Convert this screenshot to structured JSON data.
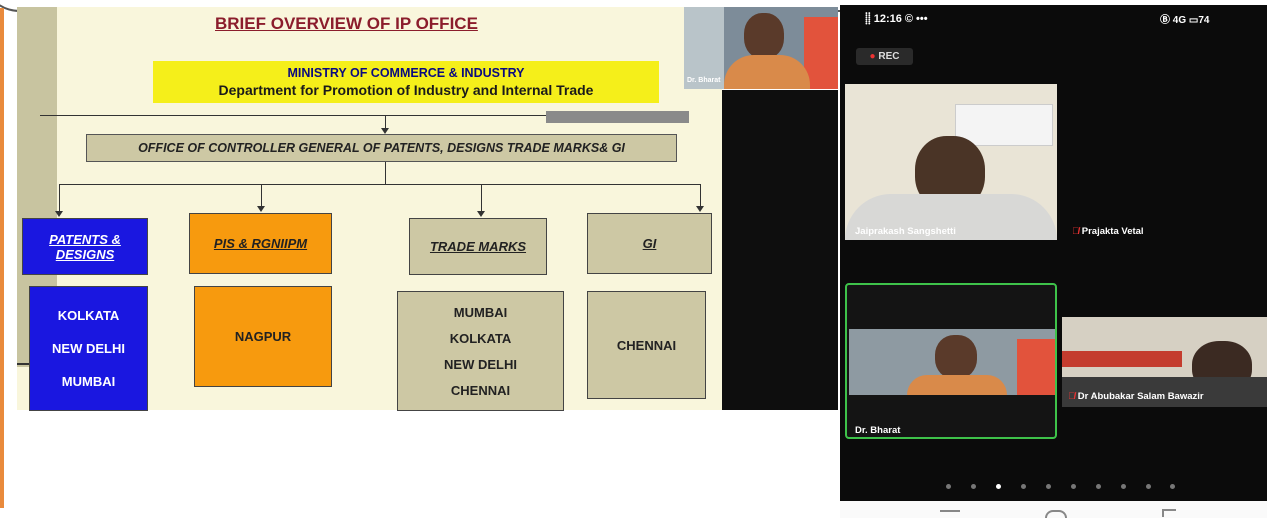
{
  "slide": {
    "title": "BRIEF OVERVIEW OF  IP  OFFICE",
    "ministry_line1": "MINISTRY OF COMMERCE & INDUSTRY",
    "ministry_line2": "Department for Promotion of Industry and Internal Trade",
    "controller_office": "OFFICE OF CONTROLLER GENERAL OF PATENTS, DESIGNS TRADE MARKS& GI",
    "branches": [
      {
        "header": "PATENTS & DESIGNS",
        "header_line1": "PATENTS &",
        "header_line2": "DESIGNS",
        "cities": [
          "KOLKATA",
          "NEW DELHI",
          "MUMBAI"
        ],
        "color": "#1a17e0"
      },
      {
        "header": "PIS & RGNIIPM",
        "cities": [
          "NAGPUR"
        ],
        "color": "#f79a0e"
      },
      {
        "header": "TRADE MARKS",
        "cities": [
          "MUMBAI",
          "KOLKATA",
          "NEW DELHI",
          "CHENNAI"
        ],
        "color": "#cdc8a4"
      },
      {
        "header": "GI",
        "cities": [
          "CHENNAI"
        ],
        "color": "#cdc8a4"
      }
    ]
  },
  "presenter_thumbnail": {
    "name": "Dr. Bharat"
  },
  "phone": {
    "status_left": "⸽⸽ 12:16 © •••",
    "status_right": "Ⓑ 4G ▭74",
    "rec_label": "REC",
    "participants": [
      {
        "name": "Jaipraksh Sangshetti",
        "display": "Jaiprakash Sangshetti"
      },
      {
        "name": "Prajakta Vetal",
        "muted": true
      },
      {
        "name": "Dr. Bharat",
        "active_speaker": true
      },
      {
        "name": "Dr Abubakar Salam Bawazir",
        "muted": true
      }
    ],
    "page_dots": 10,
    "active_dot": 2,
    "accent_color": "#3ec24a"
  }
}
